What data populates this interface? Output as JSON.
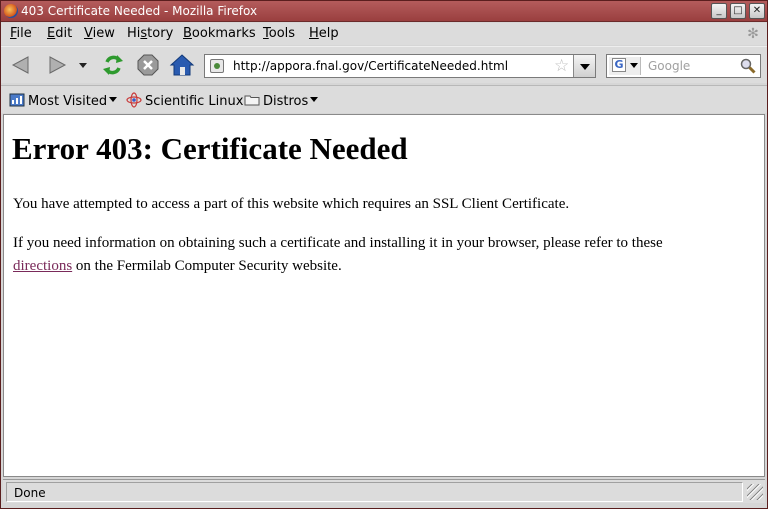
{
  "window": {
    "title": "403 Certificate Needed - Mozilla Firefox",
    "controls": {
      "minimize": "_",
      "maximize": "□",
      "close": "✕"
    }
  },
  "menubar": {
    "items": [
      {
        "label": "File",
        "accel": "F",
        "rest": "ile"
      },
      {
        "label": "Edit",
        "accel": "E",
        "rest": "dit"
      },
      {
        "label": "View",
        "accel": "V",
        "rest": "iew"
      },
      {
        "label": "History",
        "pre": "Hi",
        "accel": "s",
        "rest": "tory"
      },
      {
        "label": "Bookmarks",
        "accel": "B",
        "rest": "ookmarks"
      },
      {
        "label": "Tools",
        "accel": "T",
        "rest": "ools"
      },
      {
        "label": "Help",
        "accel": "H",
        "rest": "elp"
      }
    ]
  },
  "navbar": {
    "url": "http://appora.fnal.gov/CertificateNeeded.html",
    "search_placeholder": "Google",
    "icons": [
      "back-icon",
      "forward-icon",
      "history-dropdown-icon",
      "reload-icon",
      "stop-icon",
      "home-icon"
    ]
  },
  "bookmarks": {
    "items": [
      {
        "label": "Most Visited",
        "icon": "most-visited-icon",
        "dropdown": true
      },
      {
        "label": "Scientific Linux",
        "icon": "scientific-linux-icon",
        "dropdown": false
      },
      {
        "label": "Distros",
        "icon": "folder-icon",
        "dropdown": true
      }
    ]
  },
  "page": {
    "heading": "Error 403: Certificate Needed",
    "para1": "You have attempted to access a part of this website which requires an SSL Client Certificate.",
    "para2_line1": "If you need information on obtaining such a certificate and installing it in your browser, please refer to these",
    "para2_link": "directions",
    "para2_line2_rest": " on the Fermilab Computer Security website."
  },
  "status": {
    "text": "Done"
  },
  "colors": {
    "titlebar": "#a84c4c",
    "link_visited": "#7a2a5a"
  }
}
